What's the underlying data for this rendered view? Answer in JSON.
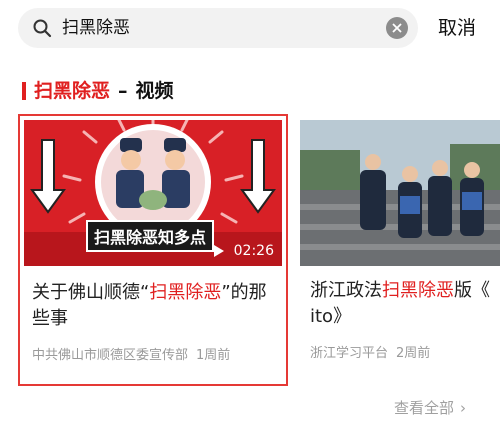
{
  "search": {
    "query": "扫黑除恶",
    "cancel_label": "取消"
  },
  "section": {
    "keyword": "扫黑除恶",
    "dash": "–",
    "suffix": "视频"
  },
  "cards": [
    {
      "thumbnail_caption": "扫黑除恶知多点",
      "duration": "02:26",
      "title_pre": "关于佛山顺德“",
      "title_highlight": "扫黑除恶",
      "title_post": "”的那些事",
      "source": "中共佛山市顺德区委宣传部",
      "time": "1周前"
    },
    {
      "title_pre": "浙江政法",
      "title_highlight": "扫黑除恶",
      "title_post": "版《",
      "title_line2": "ito》",
      "source": "浙江学习平台",
      "time": "2周前"
    }
  ],
  "footer": {
    "view_all": "查看全部",
    "chevron": "›"
  },
  "colors": {
    "accent": "#e02020",
    "selected_border": "#e53935",
    "muted_text": "#9a9a9a"
  },
  "icons": [
    "search-icon",
    "clear-icon",
    "play-icon",
    "chevron-right-icon"
  ]
}
